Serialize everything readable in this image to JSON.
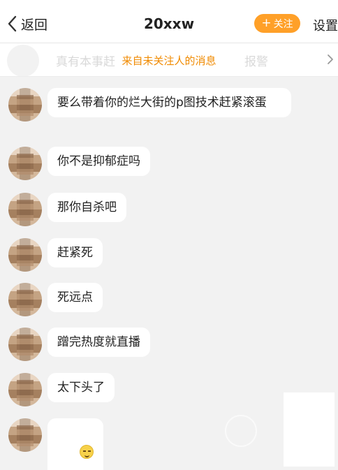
{
  "navbar": {
    "back_label": "返回",
    "title": "20xxw",
    "follow_label": "关注",
    "settings_label": "设置"
  },
  "banner": {
    "hidden_text": "真有本事赶",
    "notice": "来自未关注人的消息",
    "hidden_text_right": "报警"
  },
  "messages": [
    {
      "text": "要么带着你的烂大街的p图技术赶紧滚蛋"
    },
    {
      "text": "你不是抑郁症吗"
    },
    {
      "text": "那你自杀吧"
    },
    {
      "text": "赶紧死"
    },
    {
      "text": "死远点"
    },
    {
      "text": "蹭完热度就直播"
    },
    {
      "text": "太下头了"
    },
    {
      "emoji": "smirk-emoji"
    }
  ],
  "colors": {
    "accent": "#ffa028",
    "notice": "#f08a00",
    "background": "#f2f2f2",
    "bubble": "#ffffff"
  }
}
